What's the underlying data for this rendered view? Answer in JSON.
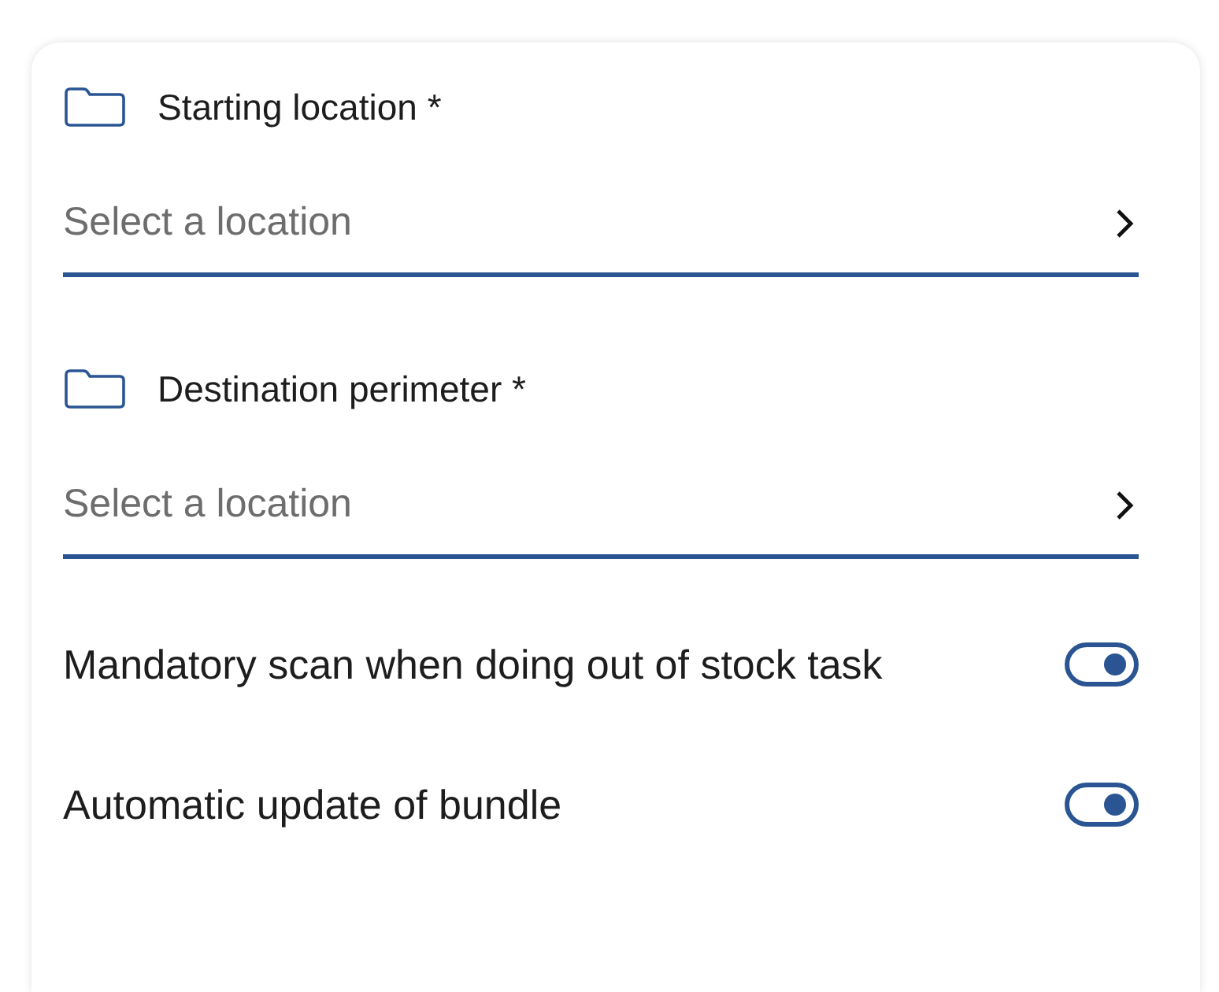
{
  "location_fields": [
    {
      "label": "Starting location *",
      "placeholder": "Select a location"
    },
    {
      "label": "Destination perimeter *",
      "placeholder": "Select a location"
    }
  ],
  "toggles": [
    {
      "label": "Mandatory scan when doing out of stock task",
      "on": true
    },
    {
      "label": "Automatic update of bundle",
      "on": true
    }
  ]
}
